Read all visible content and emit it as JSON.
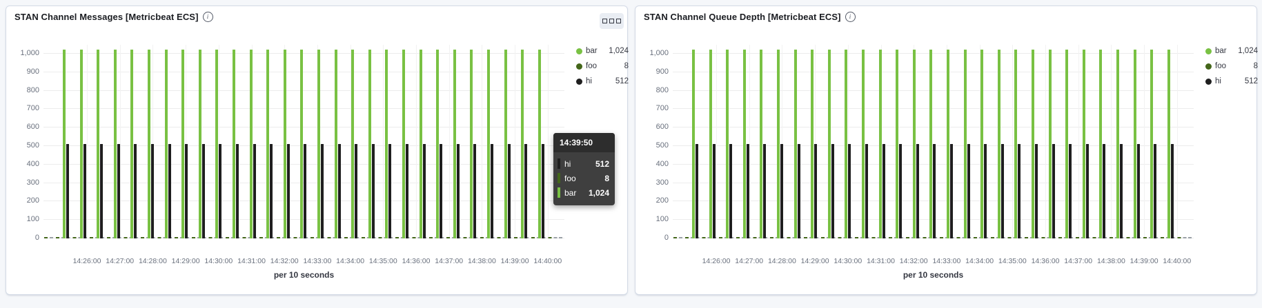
{
  "colors": {
    "page_bg": "#f5f7fa",
    "panel_bg": "#ffffff",
    "panel_border": "#d3dae6",
    "grid": "#ececec",
    "axis_text": "#69707d",
    "series_bar_green": "#79c143",
    "series_foo_darkgreen": "#44661a",
    "series_hi_black": "#1f1f1f",
    "tooltip_bg": "#3f3f3f",
    "tooltip_header_bg": "#2d2d2d"
  },
  "panels": [
    {
      "title": "STAN Channel Messages [Metricbeat ECS]",
      "info_icon_glyph": "i",
      "show_options_button": true,
      "chart_data": {
        "type": "bar",
        "title": "STAN Channel Messages [Metricbeat ECS]",
        "x_ticks": [
          "14:26:00",
          "14:27:00",
          "14:28:00",
          "14:29:00",
          "14:30:00",
          "14:31:00",
          "14:32:00",
          "14:33:00",
          "14:34:00",
          "14:35:00",
          "14:36:00",
          "14:37:00",
          "14:38:00",
          "14:39:00",
          "14:40:00"
        ],
        "xlabel": "per 10 seconds",
        "y_ticks": [
          "0",
          "100",
          "200",
          "300",
          "400",
          "500",
          "600",
          "700",
          "800",
          "900",
          "1,000"
        ],
        "ylim": [
          0,
          1000
        ],
        "grid": true,
        "legend_position": "right",
        "bucket_interval_seconds": 10,
        "series": [
          {
            "name": "bar",
            "color": "#79c143",
            "value": 1024,
            "display_value": "1,024"
          },
          {
            "name": "foo",
            "color": "#44661a",
            "value": 8,
            "display_value": "8"
          },
          {
            "name": "hi",
            "color": "#1f1f1f",
            "value": 512,
            "display_value": "512"
          }
        ]
      },
      "legend": [
        {
          "label": "bar",
          "value": "1,024",
          "color": "#79c143",
          "truncated": true
        },
        {
          "label": "foo",
          "value": "8",
          "color": "#44661a",
          "truncated": false
        },
        {
          "label": "hi",
          "value": "512",
          "color": "#1f1f1f",
          "truncated": false
        }
      ],
      "tooltip": {
        "time": "14:39:50",
        "rows": [
          {
            "label": "hi",
            "value": "512",
            "color": "#1f1f1f"
          },
          {
            "label": "foo",
            "value": "8",
            "color": "#44661a"
          },
          {
            "label": "bar",
            "value": "1,024",
            "color": "#79c143"
          }
        ]
      }
    },
    {
      "title": "STAN Channel Queue Depth [Metricbeat ECS]",
      "info_icon_glyph": "i",
      "show_options_button": false,
      "chart_data": {
        "type": "bar",
        "title": "STAN Channel Queue Depth [Metricbeat ECS]",
        "x_ticks": [
          "14:26:00",
          "14:27:00",
          "14:28:00",
          "14:29:00",
          "14:30:00",
          "14:31:00",
          "14:32:00",
          "14:33:00",
          "14:34:00",
          "14:35:00",
          "14:36:00",
          "14:37:00",
          "14:38:00",
          "14:39:00",
          "14:40:00"
        ],
        "xlabel": "per 10 seconds",
        "y_ticks": [
          "0",
          "100",
          "200",
          "300",
          "400",
          "500",
          "600",
          "700",
          "800",
          "900",
          "1,000"
        ],
        "ylim": [
          0,
          1000
        ],
        "grid": true,
        "legend_position": "right",
        "bucket_interval_seconds": 10,
        "series": [
          {
            "name": "bar",
            "color": "#79c143",
            "value": 1024,
            "display_value": "1,024"
          },
          {
            "name": "foo",
            "color": "#44661a",
            "value": 8,
            "display_value": "8"
          },
          {
            "name": "hi",
            "color": "#1f1f1f",
            "value": 512,
            "display_value": "512"
          }
        ]
      },
      "legend": [
        {
          "label": "bar",
          "value": "1,024",
          "color": "#79c143",
          "truncated": true
        },
        {
          "label": "foo",
          "value": "8",
          "color": "#44661a",
          "truncated": false
        },
        {
          "label": "hi",
          "value": "512",
          "color": "#1f1f1f",
          "truncated": false
        }
      ]
    }
  ]
}
